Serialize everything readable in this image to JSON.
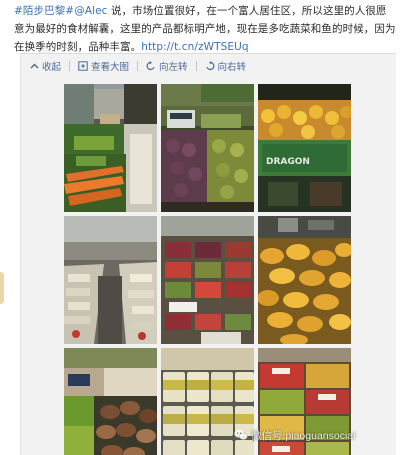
{
  "post": {
    "topic": "#陌步巴黎#",
    "mention": "Alec",
    "body": " 说，市场位置很好，在一个富人居住区，所以这里的人很愿意为最好的食材解囊，这里的产品都标明产地，现在是多吃蔬菜和鱼的时候，因为在换季的时刻，品种丰富。",
    "link": "http://t.cn/zWTSEUq"
  },
  "toolbar": {
    "collapse_label": "收起",
    "view_large_label": "查看大图",
    "rotate_left_label": "向左转",
    "rotate_right_label": "向右转"
  },
  "photos": [
    {
      "name": "photo-vegetable-stall",
      "icon": "vegetable-stall-photo"
    },
    {
      "name": "photo-fruit-scale",
      "icon": "fruit-and-scale-photo"
    },
    {
      "name": "photo-yellow-fruit",
      "icon": "yellow-fruit-photo",
      "sign": "DRAGON"
    },
    {
      "name": "photo-market-aisle",
      "icon": "market-aisle-photo"
    },
    {
      "name": "photo-berry-boxes",
      "icon": "berry-boxes-photo"
    },
    {
      "name": "photo-mushrooms",
      "icon": "chanterelle-mushrooms-photo"
    },
    {
      "name": "photo-mushroom-stall",
      "icon": "mushroom-stall-photo"
    },
    {
      "name": "photo-yogurt-jars",
      "icon": "yogurt-jars-photo"
    },
    {
      "name": "photo-fruit-crates",
      "icon": "fruit-crates-photo"
    }
  ],
  "watermark": {
    "text": "微信号:piaoguansocial",
    "icon": "wechat-icon"
  },
  "colors": {
    "link": "#3b6fb6",
    "toolbar_text": "#4a6a99",
    "repost_bg": "#f2f2f2"
  }
}
